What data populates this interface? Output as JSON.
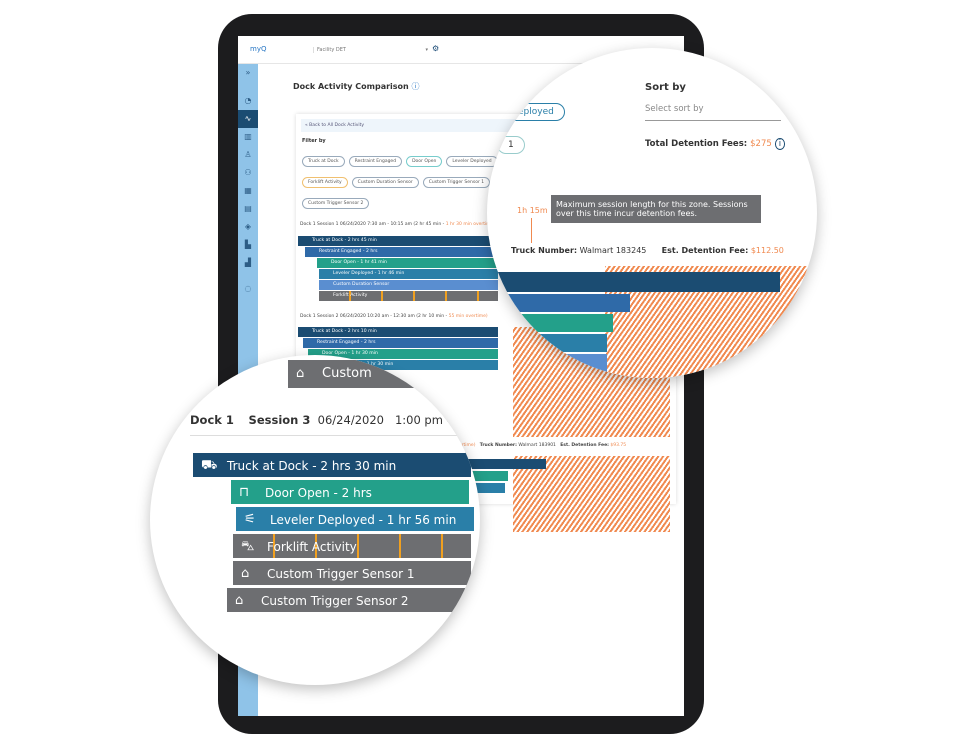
{
  "app": {
    "logo": "myQ",
    "facility": "Facility DET"
  },
  "page": {
    "title": "Dock Activity Comparison",
    "back": "« Back to All Dock Activity",
    "filter_label": "Filter by",
    "filters": [
      "Truck at Dock",
      "Restraint Engaged",
      "Door Open",
      "Leveler Deployed",
      "Forklift Activity",
      "Custom Duration Sensor",
      "Custom Trigger Sensor 1",
      "Custom Trigger Sensor 2"
    ]
  },
  "sessions": [
    {
      "header": "Dock 1   Session 1  06/24/2020   7:30 am - 10:15 am (2 hr 45 min - ",
      "overtime": "1 hr 30 min overtime)",
      "bars": [
        "Truck at Dock - 2 hrs 45 min",
        "Restraint Engaged - 2 hrs",
        "Door Open - 1 hr 41 min",
        "Leveler Deployed - 1 hr 46 min",
        "Custom Duration Sensor",
        "Forklift Activity"
      ]
    },
    {
      "header": "Dock 1   Session 2  06/24/2020   10:20 am - 12:30 am (2 hr 10 min - ",
      "overtime": "55 min overtime)",
      "bars": [
        "Truck at Dock - 2 hrs 10 min",
        "Restraint Engaged - 2 hrs",
        "Door Open - 1 hr 30 min",
        "Leveler Deployed - 1 hr 30 min"
      ]
    },
    {
      "header": "",
      "overtime": "1 hr 15 min overtime)",
      "truck_label": "Truck Number:",
      "truck": "Walmart 183901",
      "fee_label": "Est. Detention Fee:",
      "fee": "$93.75"
    }
  ],
  "zoom_top": {
    "sort_label": "Sort by",
    "sort_placeholder": "Select sort by",
    "total_label": "Total Detention Fees:",
    "total": "$275",
    "chip_partial": "eployed",
    "chip_partial2": "1",
    "limit": "1h 15m",
    "tooltip": "Maximum session length for this zone. Sessions over this time incur detention fees.",
    "truck_label": "Truck Number:",
    "truck": "Walmart 183245",
    "fee_label": "Est. Detention Fee:",
    "fee": "$112.50"
  },
  "zoom_bottom": {
    "dock": "Dock 1",
    "session": "Session 3",
    "date": "06/24/2020",
    "time": "1:00 pm -",
    "partial": "Custom",
    "bars": [
      "Truck at Dock - 2 hrs 30 min",
      "Door Open - 2 hrs",
      "Leveler Deployed - 1 hr 56 min",
      "Forklift Activity",
      "Custom Trigger Sensor 1",
      "Custom Trigger Sensor 2"
    ]
  },
  "colors": {
    "truck": "#1b4c72",
    "restraint": "#2f6aa8",
    "door": "#23a08a",
    "leveler": "#2a7fa8",
    "custom": "#5a8ed0",
    "forklift": "#6d6e71",
    "overtime": "#f08a50"
  }
}
